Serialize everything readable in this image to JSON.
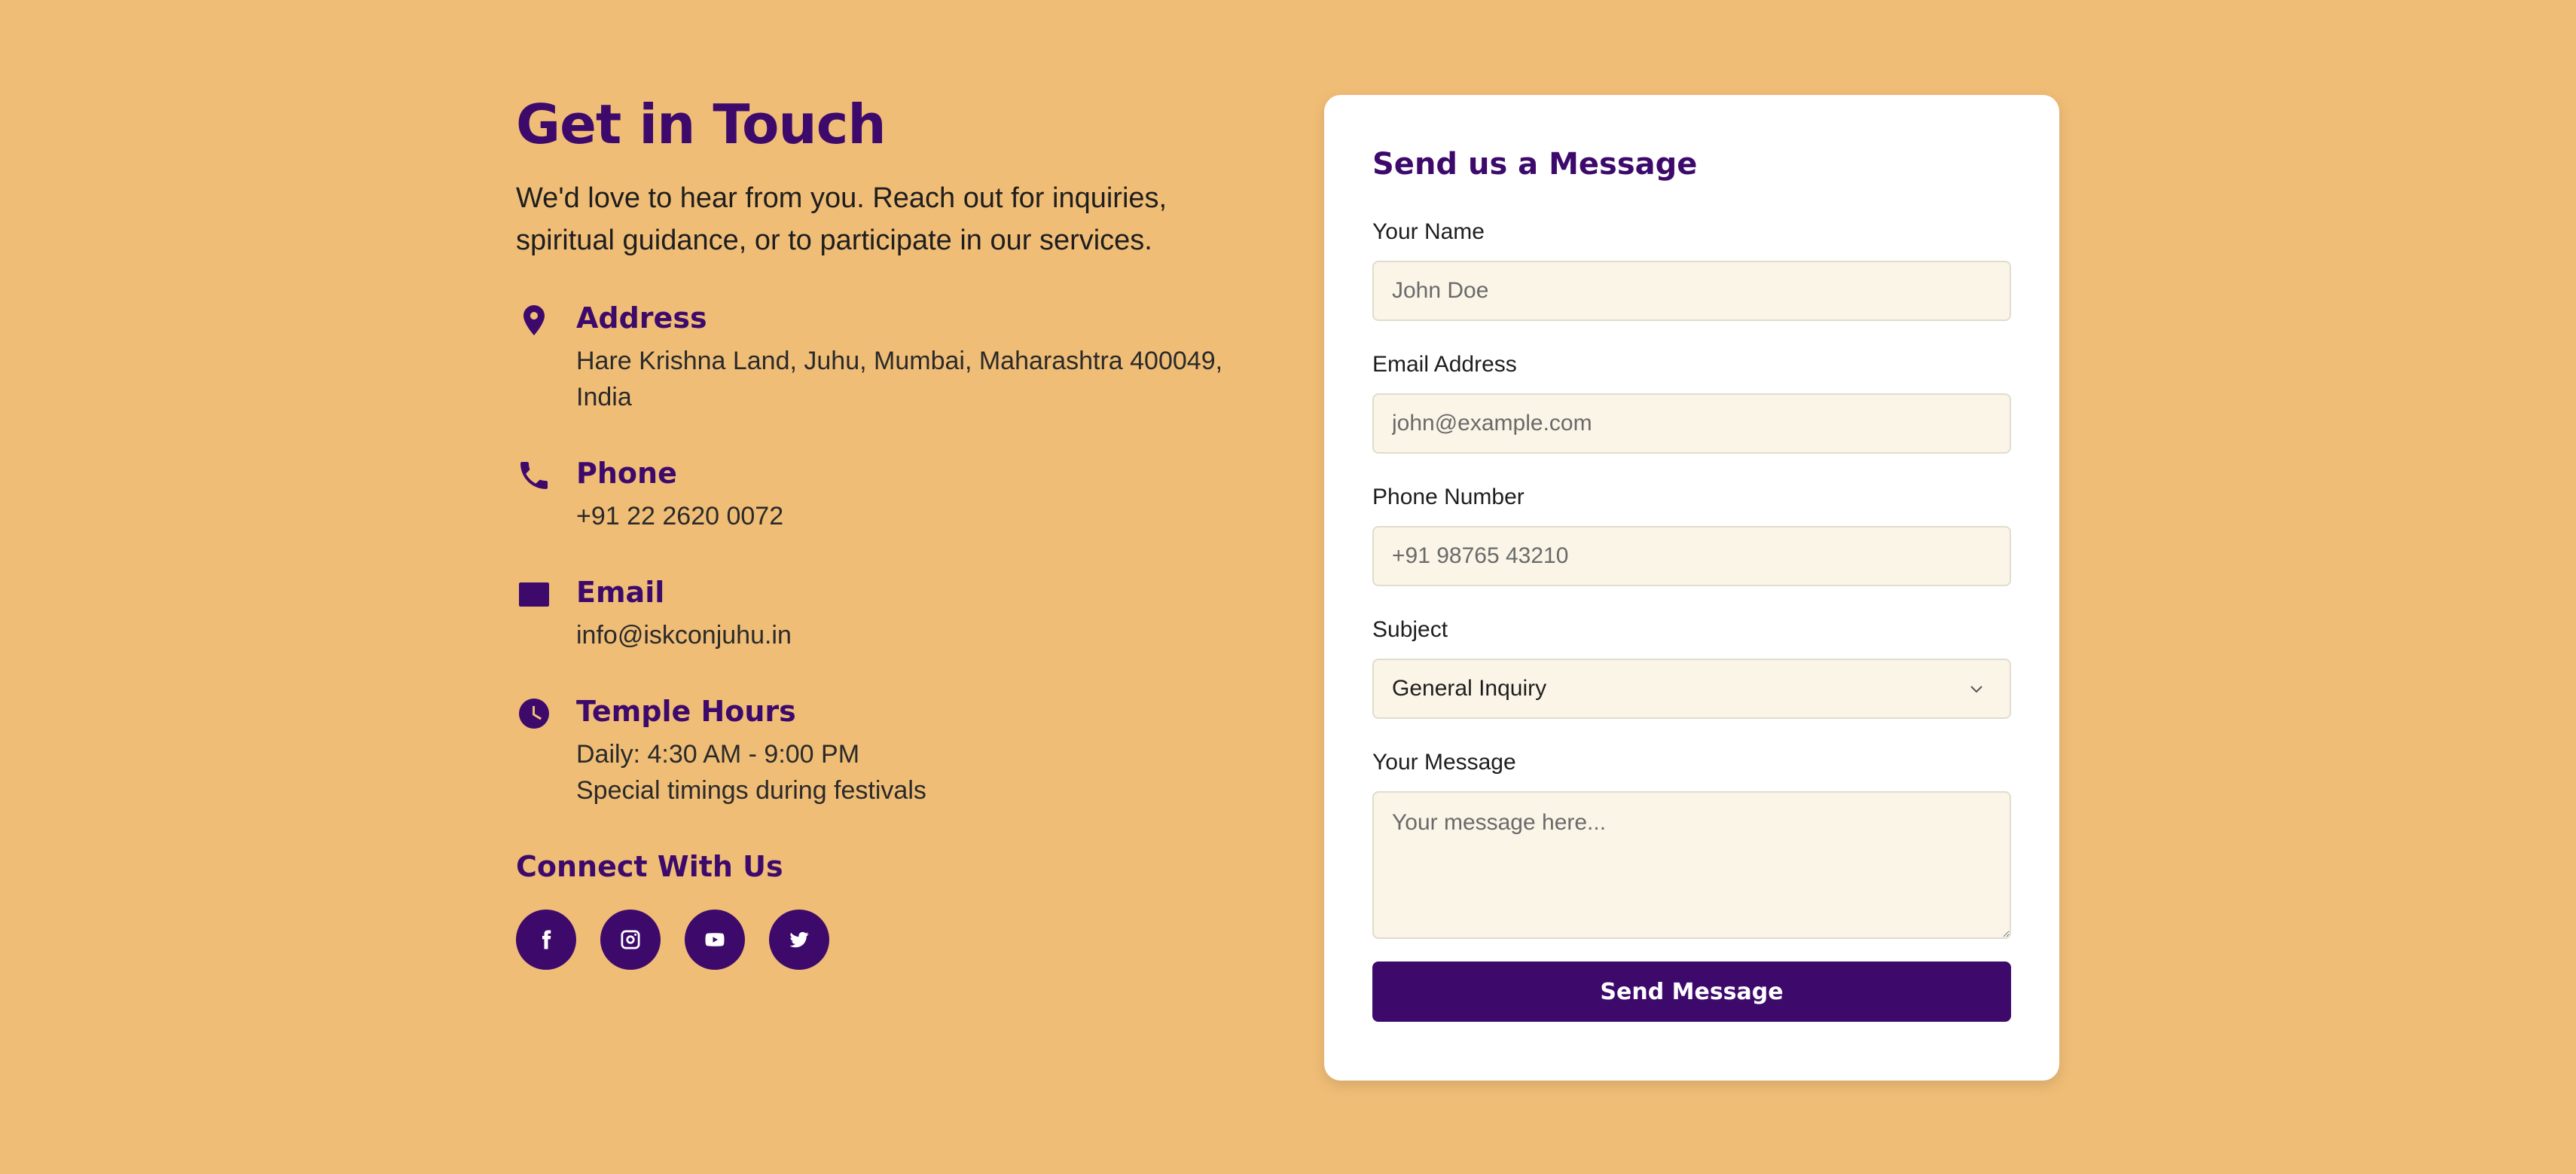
{
  "contact": {
    "title": "Get in Touch",
    "intro": "We'd love to hear from you. Reach out for inquiries, spiritual guidance, or to participate in our services.",
    "address": {
      "heading": "Address",
      "lines": [
        "Hare Krishna Land, Juhu, Mumbai, Maharashtra 400049, India"
      ],
      "icon": "map-pin-icon"
    },
    "phone": {
      "heading": "Phone",
      "lines": [
        "+91 22 2620 0072"
      ],
      "icon": "phone-icon"
    },
    "email": {
      "heading": "Email",
      "lines": [
        "info@iskconjuhu.in"
      ],
      "icon": "mail-icon"
    },
    "hours": {
      "heading": "Temple Hours",
      "lines": [
        "Daily: 4:30 AM - 9:00 PM",
        "Special timings during festivals"
      ],
      "icon": "clock-icon"
    },
    "connect": {
      "heading": "Connect With Us",
      "socials": [
        {
          "name": "facebook",
          "icon": "facebook-icon"
        },
        {
          "name": "instagram",
          "icon": "instagram-icon"
        },
        {
          "name": "youtube",
          "icon": "youtube-icon"
        },
        {
          "name": "twitter",
          "icon": "twitter-icon"
        }
      ]
    }
  },
  "form": {
    "title": "Send us a Message",
    "name": {
      "label": "Your Name",
      "placeholder": "John Doe",
      "value": ""
    },
    "email": {
      "label": "Email Address",
      "placeholder": "john@example.com",
      "value": ""
    },
    "phone": {
      "label": "Phone Number",
      "placeholder": "+91 98765 43210",
      "value": ""
    },
    "subject": {
      "label": "Subject",
      "selected": "General Inquiry"
    },
    "message": {
      "label": "Your Message",
      "placeholder": "Your message here...",
      "value": ""
    },
    "submit_label": "Send Message"
  },
  "colors": {
    "background": "#f0bd76",
    "primary": "#3d0a6c",
    "input_bg": "#fbf5e8",
    "card_bg": "#ffffff"
  }
}
